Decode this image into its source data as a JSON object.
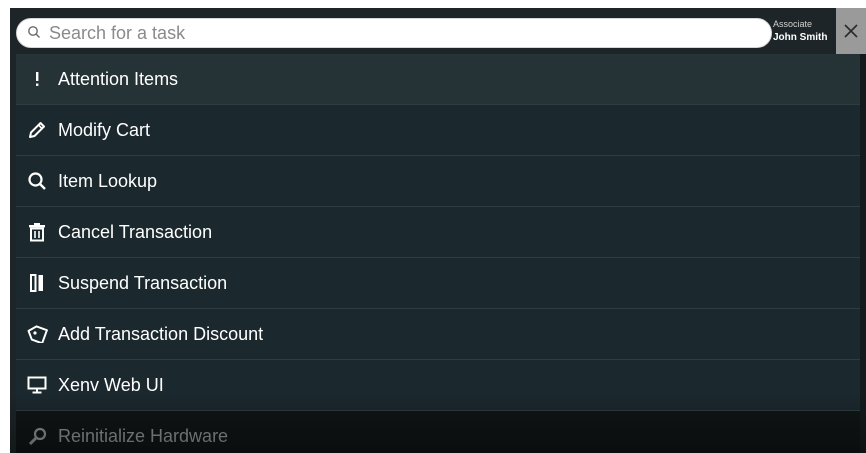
{
  "search": {
    "placeholder": "Search for a task",
    "icon": "search-icon"
  },
  "associate": {
    "role": "Associate",
    "name": "John Smith"
  },
  "close": {
    "icon": "close-icon"
  },
  "menu": {
    "items": [
      {
        "label": "Attention Items",
        "icon": "exclamation-icon"
      },
      {
        "label": "Modify Cart",
        "icon": "pencil-icon"
      },
      {
        "label": "Item Lookup",
        "icon": "search-icon"
      },
      {
        "label": "Cancel Transaction",
        "icon": "trash-icon"
      },
      {
        "label": "Suspend Transaction",
        "icon": "pause-icon"
      },
      {
        "label": "Add Transaction Discount",
        "icon": "tag-icon"
      },
      {
        "label": "Xenv Web UI",
        "icon": "monitor-icon"
      },
      {
        "label": "Reinitialize Hardware",
        "icon": "wrench-icon"
      }
    ]
  },
  "colors": {
    "background": "#1b282d",
    "highlight": "#263336",
    "text": "#ffffff",
    "close_bg": "#9a9a9a"
  }
}
